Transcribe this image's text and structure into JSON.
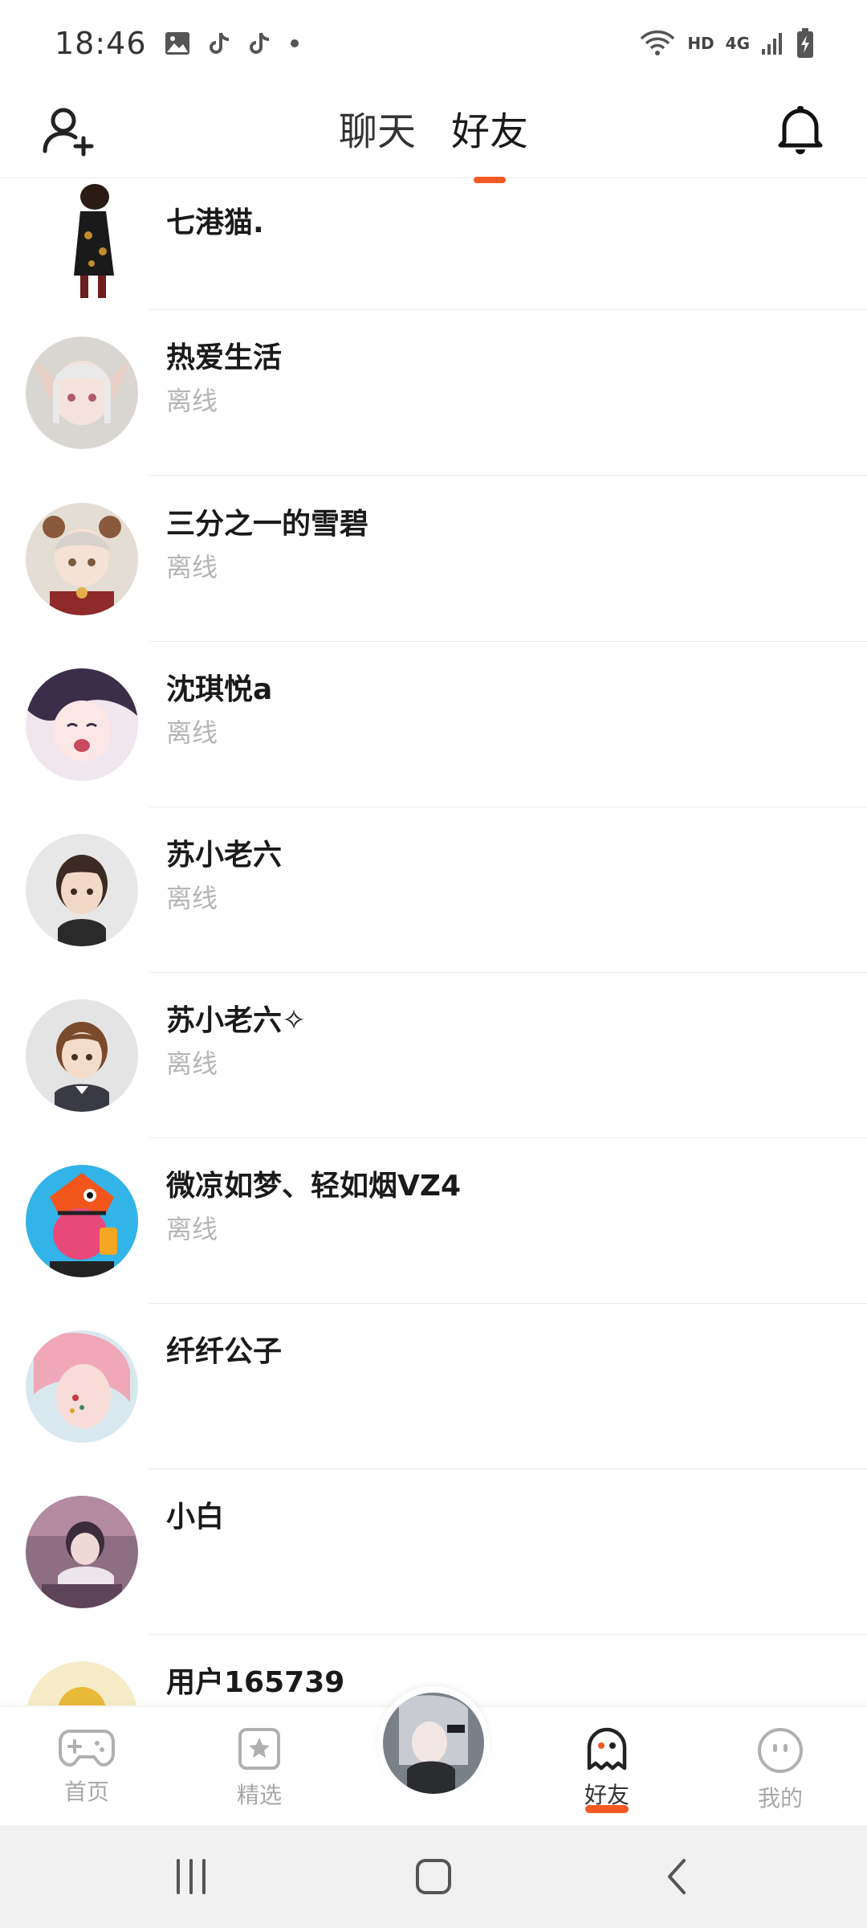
{
  "status_bar": {
    "time": "18:46",
    "notification_icons": [
      "image-icon",
      "tiktok-icon",
      "tiktok-icon",
      "dot-icon"
    ],
    "network_label": "HD",
    "cellular_label": "4G"
  },
  "header": {
    "tabs": [
      {
        "label": "聊天",
        "active": false
      },
      {
        "label": "好友",
        "active": true
      }
    ],
    "accent_color": "#f15a22"
  },
  "friends": [
    {
      "name": "七港猫.",
      "status": ""
    },
    {
      "name": "热爱生活",
      "status": "离线"
    },
    {
      "name": "三分之一的雪碧",
      "status": "离线"
    },
    {
      "name": "沈琪悦a",
      "status": "离线"
    },
    {
      "name": "苏小老六",
      "status": "离线"
    },
    {
      "name": "苏小老六✧",
      "status": "离线"
    },
    {
      "name": "微凉如梦、轻如烟VZ4",
      "status": "离线"
    },
    {
      "name": "纤纤公子",
      "status": ""
    },
    {
      "name": "小白",
      "status": ""
    },
    {
      "name": "用户165739",
      "status": ""
    }
  ],
  "bottom_nav": {
    "items": [
      {
        "label": "首页",
        "icon": "gamepad-icon",
        "active": false
      },
      {
        "label": "精选",
        "icon": "star-card-icon",
        "active": false
      },
      {
        "label": "好友",
        "icon": "ghost-icon",
        "active": true
      },
      {
        "label": "我的",
        "icon": "face-icon",
        "active": false
      }
    ]
  }
}
